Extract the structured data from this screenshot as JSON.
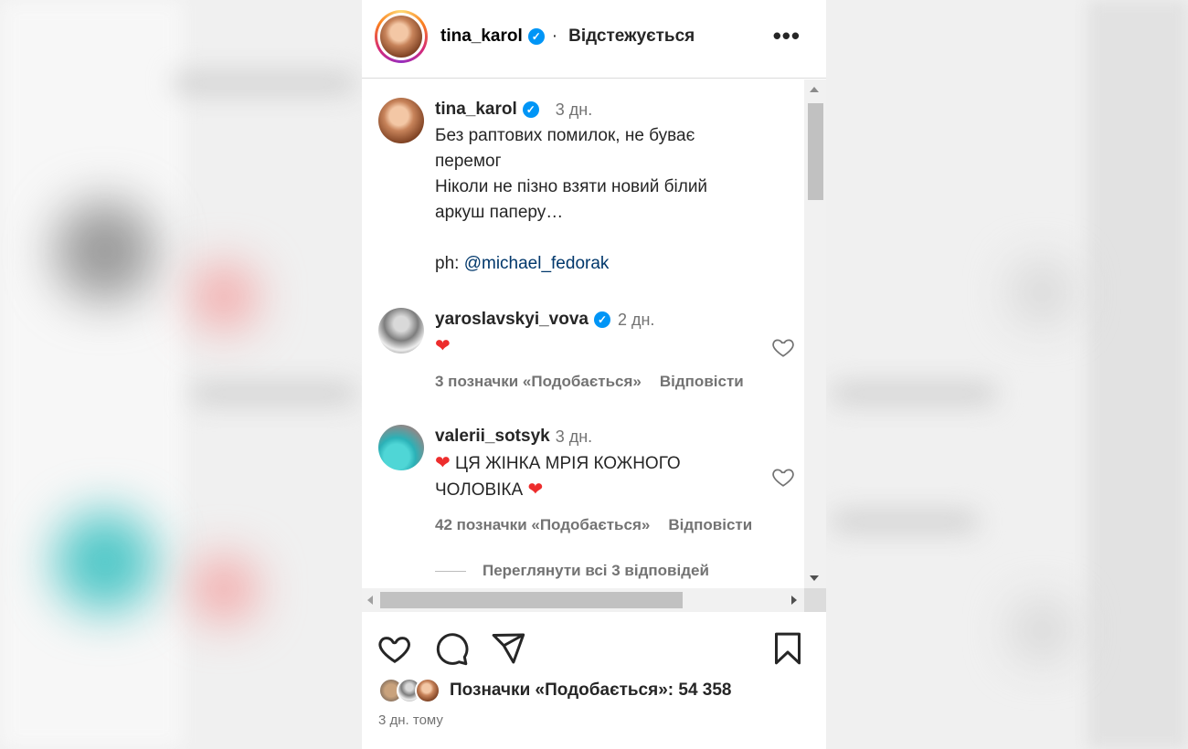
{
  "header": {
    "username": "tina_karol",
    "verified_glyph": "✓",
    "separator": "·",
    "follow_status": "Відстежується",
    "more_glyph": "•••"
  },
  "caption": {
    "username": "tina_karol",
    "time": "3 дн.",
    "line1": "Без раптових помилок, не буває",
    "line2": "перемог",
    "line3": "Ніколи не пізно взяти новий білий",
    "line4": "аркуш паперу…",
    "credit_prefix": "ph: ",
    "credit_mention": "@michael_fedorak"
  },
  "comments": [
    {
      "username": "yaroslavskyi_vova",
      "verified": true,
      "time": "2 дн.",
      "text_emoji": "❤",
      "likes": "3 позначки «Подобається»",
      "reply": "Відповісти"
    },
    {
      "username": "valerii_sotsyk",
      "verified": false,
      "time": "3 дн.",
      "emoji": "❤",
      "text_line1": " ЦЯ ЖІНКА МРІЯ КОЖНОГО",
      "text_line2": "ЧОЛОВІКА ",
      "likes": "42 позначки «Подобається»",
      "reply": "Відповісти"
    }
  ],
  "view_replies": "Переглянути всі 3 відповідей",
  "likes_summary": "Позначки «Подобається»: 54 358",
  "post_time": "3 дн. тому",
  "colors": {
    "verified": "#0095f6",
    "heart": "#ed2d2d",
    "muted": "#737373",
    "link": "#00376b"
  }
}
